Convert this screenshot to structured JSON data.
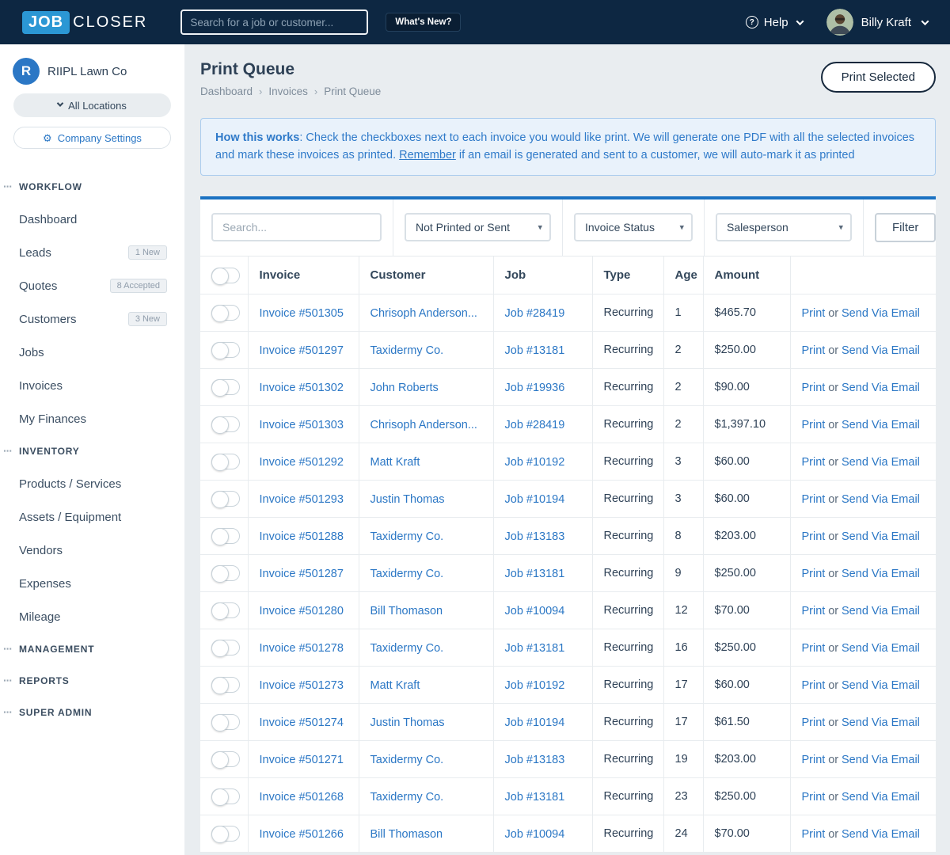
{
  "topbar": {
    "logo_part1": "JOB",
    "logo_part2": "CLOSER",
    "search_placeholder": "Search for a job or customer...",
    "whats_new_label": "What's New?",
    "help_label": "Help",
    "user_name": "Billy Kraft"
  },
  "sidebar": {
    "company_initial": "R",
    "company_name": "RIIPL Lawn Co",
    "locations_label": "All Locations",
    "settings_label": "Company Settings",
    "sections": [
      {
        "label": "WORKFLOW",
        "items": [
          {
            "label": "Dashboard",
            "badge": ""
          },
          {
            "label": "Leads",
            "badge": "1 New"
          },
          {
            "label": "Quotes",
            "badge": "8 Accepted"
          },
          {
            "label": "Customers",
            "badge": "3 New"
          },
          {
            "label": "Jobs",
            "badge": ""
          },
          {
            "label": "Invoices",
            "badge": ""
          },
          {
            "label": "My Finances",
            "badge": ""
          }
        ]
      },
      {
        "label": "INVENTORY",
        "items": [
          {
            "label": "Products / Services",
            "badge": ""
          },
          {
            "label": "Assets / Equipment",
            "badge": ""
          },
          {
            "label": "Vendors",
            "badge": ""
          },
          {
            "label": "Expenses",
            "badge": ""
          },
          {
            "label": "Mileage",
            "badge": ""
          }
        ]
      },
      {
        "label": "MANAGEMENT",
        "items": []
      },
      {
        "label": "REPORTS",
        "items": []
      },
      {
        "label": "SUPER ADMIN",
        "items": []
      }
    ]
  },
  "main": {
    "title": "Print Queue",
    "breadcrumb": [
      "Dashboard",
      "Invoices",
      "Print Queue"
    ],
    "print_selected_label": "Print Selected",
    "info_bold": "How this works",
    "info_text1": ": Check the checkboxes next to each invoice you would like print. We will generate one PDF with all the selected invoices and mark these invoices as printed. ",
    "info_underline": "Remember",
    "info_text2": " if an email is generated and sent to a customer, we will auto-mark it as printed",
    "filters": {
      "search_placeholder": "Search...",
      "selects": [
        "Not Printed or Sent",
        "Invoice Status",
        "Salesperson"
      ],
      "filter_label": "Filter"
    },
    "table": {
      "headers": [
        "Invoice",
        "Customer",
        "Job",
        "Type",
        "Age",
        "Amount"
      ],
      "action_print": "Print",
      "action_or": "or",
      "action_email": "Send Via Email",
      "rows": [
        {
          "invoice": "Invoice #501305",
          "customer": "Chrisoph Anderson...",
          "job": "Job #28419",
          "type": "Recurring",
          "age": "1",
          "amount": "$465.70"
        },
        {
          "invoice": "Invoice #501297",
          "customer": "Taxidermy Co.",
          "job": "Job #13181",
          "type": "Recurring",
          "age": "2",
          "amount": "$250.00"
        },
        {
          "invoice": "Invoice #501302",
          "customer": "John Roberts",
          "job": "Job #19936",
          "type": "Recurring",
          "age": "2",
          "amount": "$90.00"
        },
        {
          "invoice": "Invoice #501303",
          "customer": "Chrisoph Anderson...",
          "job": "Job #28419",
          "type": "Recurring",
          "age": "2",
          "amount": "$1,397.10"
        },
        {
          "invoice": "Invoice #501292",
          "customer": "Matt Kraft",
          "job": "Job #10192",
          "type": "Recurring",
          "age": "3",
          "amount": "$60.00"
        },
        {
          "invoice": "Invoice #501293",
          "customer": "Justin Thomas",
          "job": "Job #10194",
          "type": "Recurring",
          "age": "3",
          "amount": "$60.00"
        },
        {
          "invoice": "Invoice #501288",
          "customer": "Taxidermy Co.",
          "job": "Job #13183",
          "type": "Recurring",
          "age": "8",
          "amount": "$203.00"
        },
        {
          "invoice": "Invoice #501287",
          "customer": "Taxidermy Co.",
          "job": "Job #13181",
          "type": "Recurring",
          "age": "9",
          "amount": "$250.00"
        },
        {
          "invoice": "Invoice #501280",
          "customer": "Bill Thomason",
          "job": "Job #10094",
          "type": "Recurring",
          "age": "12",
          "amount": "$70.00"
        },
        {
          "invoice": "Invoice #501278",
          "customer": "Taxidermy Co.",
          "job": "Job #13181",
          "type": "Recurring",
          "age": "16",
          "amount": "$250.00"
        },
        {
          "invoice": "Invoice #501273",
          "customer": "Matt Kraft",
          "job": "Job #10192",
          "type": "Recurring",
          "age": "17",
          "amount": "$60.00"
        },
        {
          "invoice": "Invoice #501274",
          "customer": "Justin Thomas",
          "job": "Job #10194",
          "type": "Recurring",
          "age": "17",
          "amount": "$61.50"
        },
        {
          "invoice": "Invoice #501271",
          "customer": "Taxidermy Co.",
          "job": "Job #13183",
          "type": "Recurring",
          "age": "19",
          "amount": "$203.00"
        },
        {
          "invoice": "Invoice #501268",
          "customer": "Taxidermy Co.",
          "job": "Job #13181",
          "type": "Recurring",
          "age": "23",
          "amount": "$250.00"
        },
        {
          "invoice": "Invoice #501266",
          "customer": "Bill Thomason",
          "job": "Job #10094",
          "type": "Recurring",
          "age": "24",
          "amount": "$70.00"
        }
      ]
    }
  },
  "colors": {
    "topbar_navy": "#0d2742",
    "brand_blue": "#2b97d4",
    "link_blue": "#2b77c5",
    "card_accent_blue": "#1b72c2",
    "info_bg": "#e9f2fb"
  }
}
